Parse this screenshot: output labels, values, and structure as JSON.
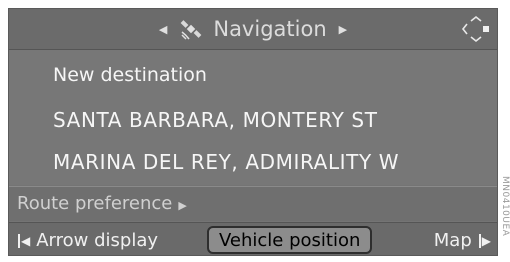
{
  "title_bar": {
    "title": "Navigation",
    "left_arrow_icon": "triangle-left-small",
    "right_arrow_icon": "triangle-right-small",
    "title_icon": "satellite-icon",
    "controller_icon": "controller-directions-icon"
  },
  "menu": {
    "items": [
      {
        "label": "New destination"
      },
      {
        "label": "SANTA BARBARA, MONTERY ST"
      },
      {
        "label": "MARINA DEL REY, ADMIRALITY W"
      }
    ]
  },
  "route": {
    "label": "Route preference",
    "arrow_icon": "triangle-right-small"
  },
  "bottom_bar": {
    "arrow_display": "Arrow display",
    "vehicle_position": "Vehicle position",
    "map": "Map"
  },
  "side_code": "MN0410UEA",
  "colors": {
    "screen_bg": "#747474",
    "text": "#f6f6f6",
    "selected_bg": "#8c8c8c",
    "selected_text": "#000000"
  }
}
